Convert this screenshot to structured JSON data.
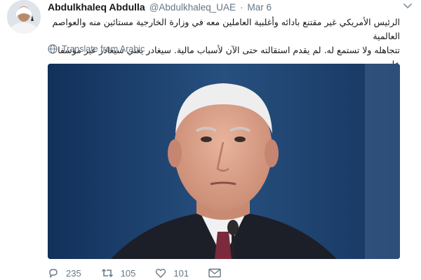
{
  "tweet": {
    "author_name": "Abdulkhaleq Abdulla",
    "author_handle": "@Abdulkhaleq_UAE",
    "separator": "·",
    "date": "Mar 6",
    "text_line_1": "الرئيس الأمريكي غير مقتنع بادائه وأغلبية العاملين معه في وزارة الخارجية مستائين منه والعواصم العالمية",
    "text_line_2": "تتجاهله ولا تستمع له. لم يقدم استقالته حتى الآن لأسباب مالية. سيغادر يعني سيغادر غير مؤسفا عليه.",
    "translate_label": "Translate from Arabic",
    "actions": {
      "replies": "235",
      "retweets": "105",
      "likes": "101"
    }
  },
  "icons": {
    "avatar": "avatar",
    "menu": "chevron-down-icon",
    "translate": "globe-icon",
    "reply": "reply-icon",
    "retweet": "retweet-icon",
    "like": "heart-icon",
    "dm": "envelope-icon"
  },
  "colors": {
    "text": "#14171a",
    "secondary": "#657786",
    "photo_background": "#1b3a63"
  }
}
